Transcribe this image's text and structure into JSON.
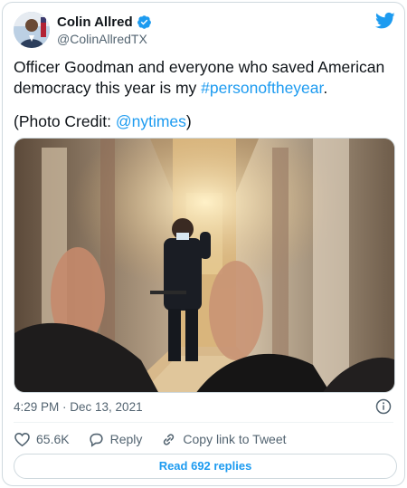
{
  "author": {
    "display_name": "Colin Allred",
    "handle": "@ColinAllredTX",
    "verified": true
  },
  "tweet": {
    "text_before": "Officer Goodman and everyone who saved American democracy this year is my ",
    "hashtag": "#personoftheyear",
    "text_after": ".",
    "credit_prefix": "(Photo Credit: ",
    "credit_mention": "@nytimes",
    "credit_suffix": ")"
  },
  "meta": {
    "timestamp": "4:29 PM · Dec 13, 2021"
  },
  "actions": {
    "likes": "65.6K",
    "reply_label": "Reply",
    "copy_label": "Copy link to Tweet"
  },
  "replies_button": "Read 692 replies",
  "colors": {
    "accent": "#1d9bf0",
    "like_icon": "#536471",
    "text": "#0f1419",
    "secondary": "#536471"
  }
}
